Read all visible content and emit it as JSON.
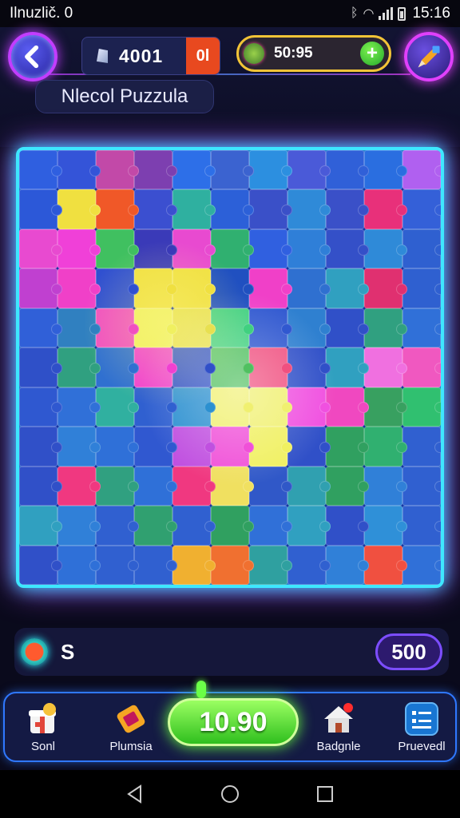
{
  "status_bar": {
    "time_left": "Ilnuzlič. 0",
    "time_right": "15:16"
  },
  "header": {
    "gems_value": "4001",
    "gems_badge": "0l",
    "timer_value": "50:95",
    "plus_symbol": "+",
    "title": "Nlecol Puzzula"
  },
  "board": {
    "columns": 11,
    "rows": 11,
    "colors": [
      [
        "#2f5fe0",
        "#3454d8",
        "#c249a8",
        "#7d3fb0",
        "#2d6fe8",
        "#3b63d0",
        "#2c8fe0",
        "#4a5ad8",
        "#3060d8",
        "#2a6ee0",
        "#b060f0"
      ],
      [
        "#2c58d8",
        "#f0e040",
        "#f05828",
        "#3b4fd0",
        "#2fb0a0",
        "#2c60d8",
        "#3a50c8",
        "#2f8ad8",
        "#3a50c8",
        "#e8307a",
        "#3460d8"
      ],
      [
        "#e84ad0",
        "#f040d8",
        "#40c060",
        "#3a3ab8",
        "#e84ad0",
        "#30b070",
        "#3060e0",
        "#2f7fd8",
        "#3450c8",
        "#2f8ad8",
        "#2f60d0"
      ],
      [
        "#c040d0",
        "#f040c8",
        "#3050d0",
        "#f0e040",
        "#f0e040",
        "#2050c0",
        "#f040c8",
        "#2f70d0",
        "#30a0c0",
        "#e03070",
        "#2f60d0"
      ],
      [
        "#3060d8",
        "#3080c0",
        "#f050c0",
        "#f0f060",
        "#e8e050",
        "#40d080",
        "#3058d0",
        "#2f80d0",
        "#3050c8",
        "#30a080",
        "#3070d8"
      ],
      [
        "#2f50c8",
        "#30a080",
        "#3070d0",
        "#f040d0",
        "#3050c8",
        "#50c060",
        "#f05080",
        "#3050c8",
        "#30a0c0",
        "#f070e0",
        "#f058c0"
      ],
      [
        "#2f58d0",
        "#3070d8",
        "#30b0a0",
        "#3060d0",
        "#2c90d0",
        "#f0f070",
        "#f0f070",
        "#f050e0",
        "#f048c0",
        "#38a060",
        "#30c070"
      ],
      [
        "#3050c8",
        "#3080d8",
        "#2f70d8",
        "#3058d0",
        "#c050e0",
        "#f050d8",
        "#f0f060",
        "#3050c8",
        "#30a060",
        "#30b070",
        "#3060d0"
      ],
      [
        "#3050c8",
        "#f03880",
        "#30a080",
        "#2f70d8",
        "#f03880",
        "#f0e060",
        "#3058c8",
        "#30a0b0",
        "#30a060",
        "#3080d8",
        "#3060d0"
      ],
      [
        "#30a0c0",
        "#3080d8",
        "#3060d0",
        "#30a070",
        "#3060d0",
        "#30a060",
        "#3070d8",
        "#30a0c0",
        "#3050c8",
        "#2f90d8",
        "#3060d0"
      ],
      [
        "#3050c8",
        "#2f70d8",
        "#3060d0",
        "#3060d0",
        "#f0b030",
        "#f07030",
        "#2fa0a0",
        "#3060d0",
        "#3080d8",
        "#f05040",
        "#3070d8"
      ]
    ]
  },
  "score": {
    "label": "S",
    "value": "500"
  },
  "nav": {
    "items": [
      {
        "label": "Sonl",
        "icon": "gift-icon"
      },
      {
        "label": "Plumsia",
        "icon": "ticket-icon"
      },
      {
        "label": "Badgnle",
        "icon": "home-icon"
      },
      {
        "label": "Pruevedl",
        "icon": "list-icon"
      }
    ],
    "play_label": "10.90"
  },
  "colors": {
    "board_border": "#3ee7ff",
    "accent_purple": "#c23dff",
    "play_green": "#2fbf1e"
  }
}
